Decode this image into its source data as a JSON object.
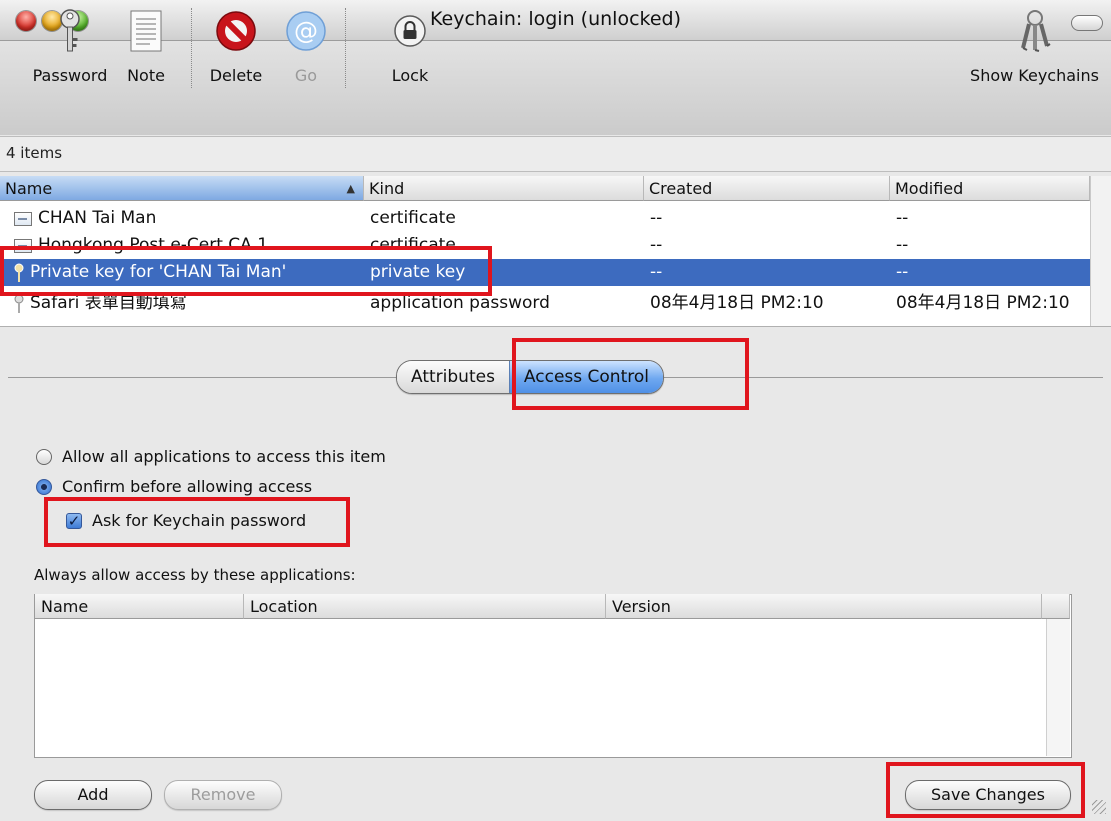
{
  "window": {
    "title": "Keychain: login (unlocked)"
  },
  "toolbar": {
    "password": "Password",
    "note": "Note",
    "delete": "Delete",
    "go": "Go",
    "lock": "Lock",
    "show_keychains": "Show Keychains"
  },
  "status": {
    "items_count": "4 items"
  },
  "table": {
    "columns": {
      "name": "Name",
      "kind": "Kind",
      "created": "Created",
      "modified": "Modified"
    },
    "rows": [
      {
        "icon": "certificate-icon",
        "name": "CHAN Tai Man",
        "kind": "certificate",
        "created": "--",
        "modified": "--"
      },
      {
        "icon": "certificate-icon",
        "name": "Hongkong Post e-Cert CA 1",
        "kind": "certificate",
        "created": "--",
        "modified": "--"
      },
      {
        "icon": "key-icon",
        "name": "Private key for 'CHAN Tai Man'",
        "kind": "private key",
        "created": "--",
        "modified": "--",
        "selected": true
      },
      {
        "icon": "key-icon",
        "name": "Safari 表單自動填寫",
        "kind": "application password",
        "created": "08年4月18日 PM2:10",
        "modified": "08年4月18日 PM2:10"
      }
    ]
  },
  "tabs": {
    "attributes": "Attributes",
    "access_control": "Access Control",
    "selected": "access_control"
  },
  "access": {
    "allow_all": "Allow all applications to access this item",
    "confirm": "Confirm before allowing access",
    "ask_password": "Ask for Keychain password",
    "ask_password_checked": true,
    "selected_option": "confirm",
    "always_allow_label": "Always allow access by these applications:",
    "apps_columns": {
      "name": "Name",
      "location": "Location",
      "version": "Version"
    },
    "apps": []
  },
  "buttons": {
    "add": "Add",
    "remove": "Remove",
    "save": "Save Changes"
  },
  "colors": {
    "selection": "#3d6bbf",
    "annotation": "#e0151d",
    "aqua": "#4f90e6"
  }
}
